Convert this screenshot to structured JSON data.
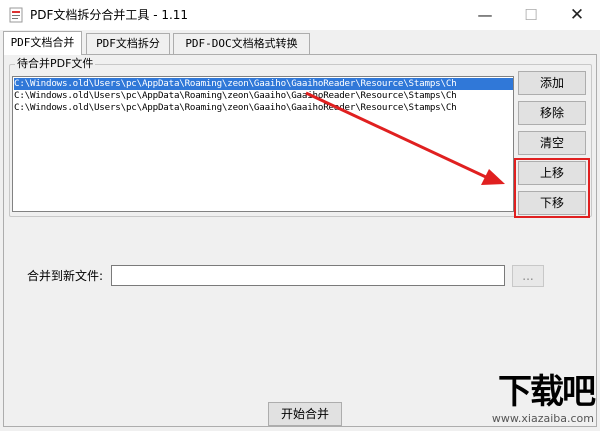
{
  "window": {
    "title": "PDF文档拆分合并工具 - 1.11",
    "minimize_glyph": "—",
    "maximize_glyph": "☐",
    "close_glyph": "✕"
  },
  "tabs": [
    {
      "label": "PDF文档合并",
      "active": true
    },
    {
      "label": "PDF文档拆分",
      "active": false
    },
    {
      "label": "PDF-DOC文档格式转换",
      "active": false
    }
  ],
  "merge": {
    "group_label": "待合并PDF文件",
    "files": [
      {
        "path": "C:\\Windows.old\\Users\\pc\\AppData\\Roaming\\zeon\\Gaaiho\\GaaihoReader\\Resource\\Stamps\\Ch",
        "selected": true
      },
      {
        "path": "C:\\Windows.old\\Users\\pc\\AppData\\Roaming\\zeon\\Gaaiho\\GaaihoReader\\Resource\\Stamps\\Ch",
        "selected": false
      },
      {
        "path": "C:\\Windows.old\\Users\\pc\\AppData\\Roaming\\zeon\\Gaaiho\\GaaihoReader\\Resource\\Stamps\\Ch",
        "selected": false
      }
    ],
    "buttons": {
      "add": "添加",
      "remove": "移除",
      "clear": "清空",
      "up": "上移",
      "down": "下移"
    },
    "output_label": "合并到新文件:",
    "output_value": "",
    "browse_label": "...",
    "start_label": "开始合并"
  },
  "watermark": {
    "text": "下载吧",
    "url": "www.xiazaiba.com"
  },
  "colors": {
    "selection": "#3078d8",
    "annotation_red": "#e02020"
  }
}
